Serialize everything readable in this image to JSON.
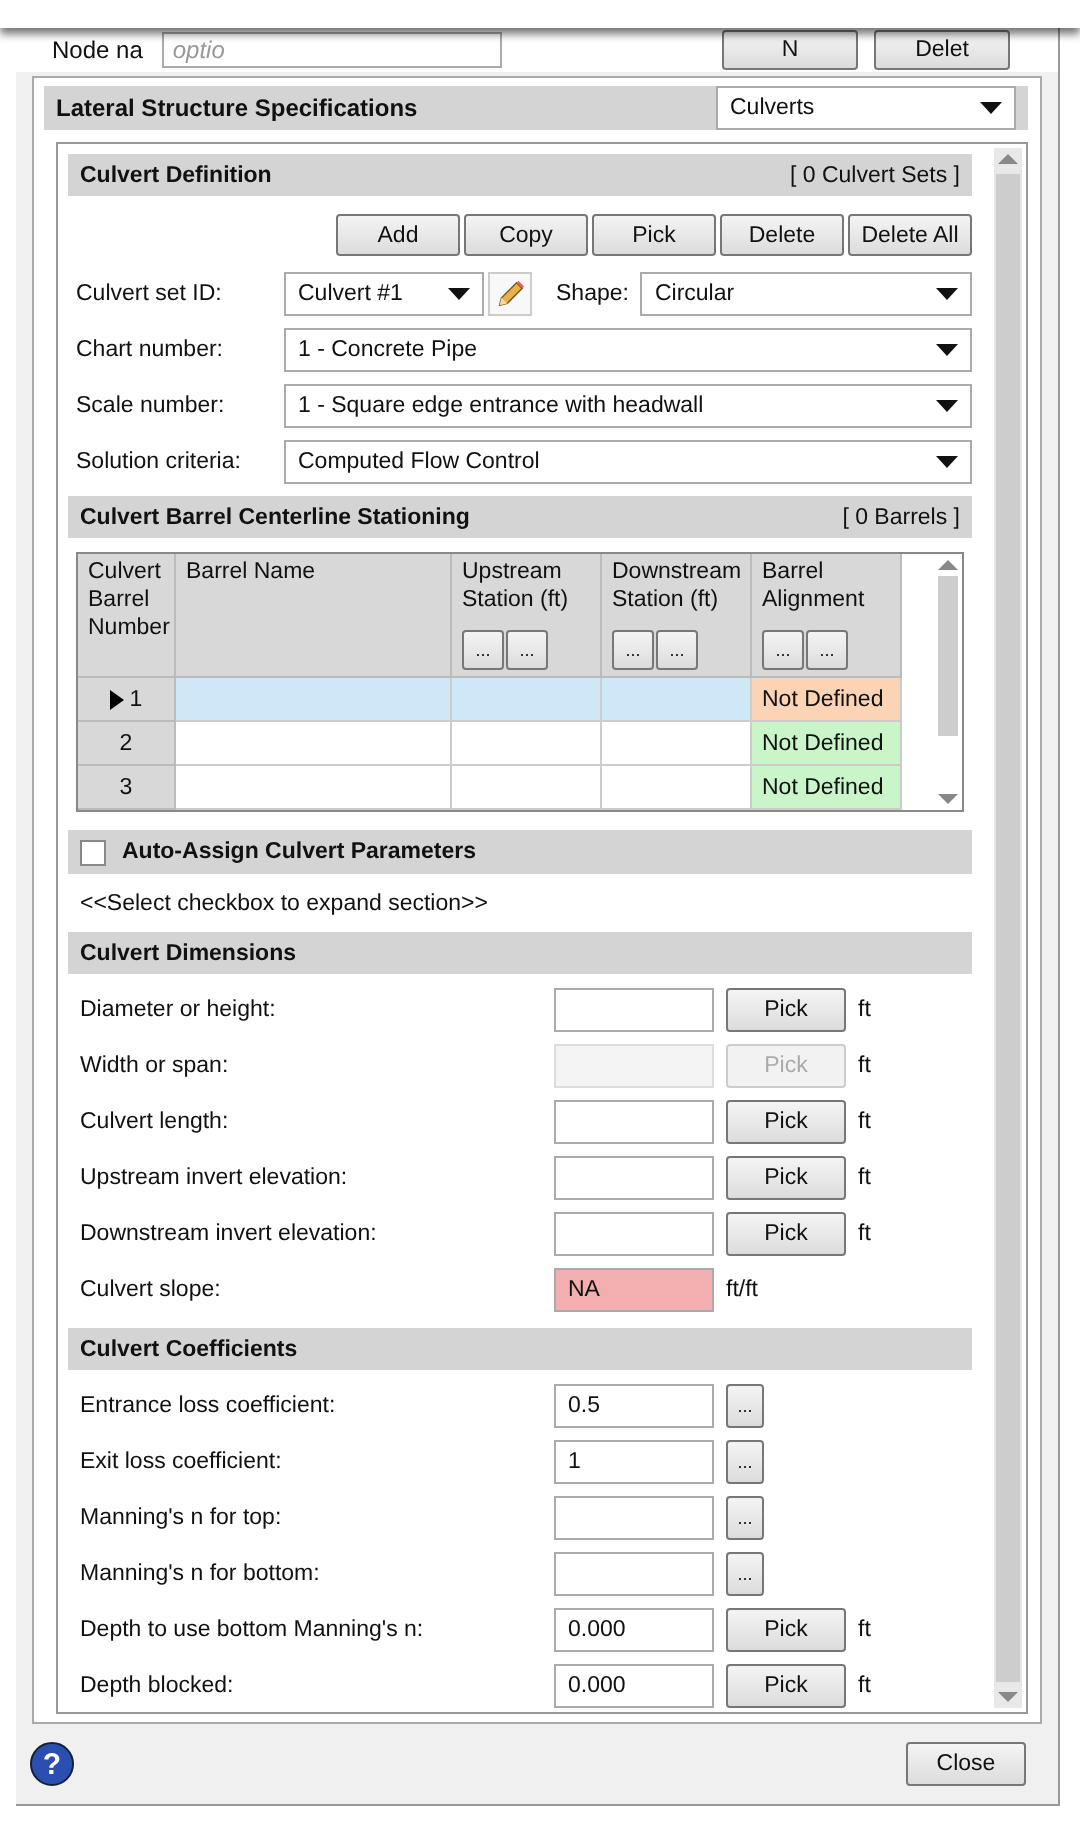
{
  "top_strip": {
    "label": "Node na",
    "field": {
      "placeholder": "optio"
    },
    "buttons": [
      "N",
      "Delet"
    ]
  },
  "specs": {
    "title": "Lateral Structure Specifications",
    "type": "Culverts"
  },
  "culvert_definition": {
    "title": "Culvert Definition",
    "count": "[ 0 Culvert Sets ]",
    "buttons": [
      "Add",
      "Copy",
      "Pick",
      "Delete",
      "Delete All"
    ],
    "culvert_set_id": {
      "label": "Culvert set ID:",
      "value": "Culvert #1"
    },
    "shape": {
      "label": "Shape:",
      "value": "Circular"
    },
    "dropdowns": [
      {
        "label": "Chart number:",
        "value": "1 - Concrete Pipe"
      },
      {
        "label": "Scale number:",
        "value": "1 - Square edge entrance with headwall"
      },
      {
        "label": "Solution criteria:",
        "value": "Computed Flow Control"
      }
    ]
  },
  "stationing": {
    "title": "Culvert Barrel Centerline Stationing",
    "count": "[ 0 Barrels ]",
    "columns": [
      {
        "label": "Culvert Barrel Number"
      },
      {
        "label": "Barrel Name"
      },
      {
        "label": "Upstream Station (ft)",
        "buttons": [
          "...",
          "..."
        ]
      },
      {
        "label": "Downstream Station (ft)",
        "buttons": [
          "...",
          "..."
        ]
      },
      {
        "label": "Barrel Alignment",
        "buttons": [
          "...",
          "..."
        ]
      }
    ],
    "rows": [
      {
        "number": "1",
        "selected": true,
        "alignment": "Not Defined",
        "color": "#fbd3b5"
      },
      {
        "number": "2",
        "selected": false,
        "alignment": "Not Defined",
        "color": "#c9f5c9"
      },
      {
        "number": "3",
        "selected": false,
        "alignment": "Not Defined",
        "color": "#c9f5c9"
      }
    ]
  },
  "auto_assign": {
    "title": "Auto-Assign Culvert Parameters",
    "checked": false,
    "hint": "<<Select checkbox to expand section>>"
  },
  "dimensions": {
    "title": "Culvert Dimensions",
    "rows": [
      {
        "label": "Diameter or height:",
        "kind": "pick",
        "button": "Pick",
        "unit": "ft",
        "disabled": false
      },
      {
        "label": "Width or span:",
        "kind": "pick",
        "button": "Pick",
        "unit": "ft",
        "disabled": true
      },
      {
        "label": "Culvert length:",
        "kind": "pick",
        "button": "Pick",
        "unit": "ft",
        "disabled": false
      },
      {
        "label": "Upstream invert elevation:",
        "kind": "pick",
        "button": "Pick",
        "unit": "ft",
        "disabled": false
      },
      {
        "label": "Downstream invert elevation:",
        "kind": "pick",
        "button": "Pick",
        "unit": "ft",
        "disabled": false
      },
      {
        "label": "Culvert slope:",
        "kind": "readout",
        "value": "NA",
        "unit": "ft/ft"
      }
    ]
  },
  "coefficients": {
    "title": "Culvert Coefficients",
    "rows": [
      {
        "label": "Entrance loss coefficient:",
        "kind": "more",
        "value": "0.5",
        "button": "..."
      },
      {
        "label": "Exit loss coefficient:",
        "kind": "more",
        "value": "1",
        "button": "..."
      },
      {
        "label": "Manning's n for top:",
        "kind": "more",
        "button": "..."
      },
      {
        "label": "Manning's n for bottom:",
        "kind": "more",
        "button": "..."
      },
      {
        "label": "Depth to use bottom Manning's n:",
        "kind": "pick",
        "value": "0.000",
        "button": "Pick",
        "unit": "ft",
        "disabled": false
      },
      {
        "label": "Depth blocked:",
        "kind": "pick",
        "value": "0.000",
        "button": "Pick",
        "unit": "ft",
        "disabled": false
      }
    ]
  },
  "footer": {
    "help": "?",
    "close": "Close"
  }
}
